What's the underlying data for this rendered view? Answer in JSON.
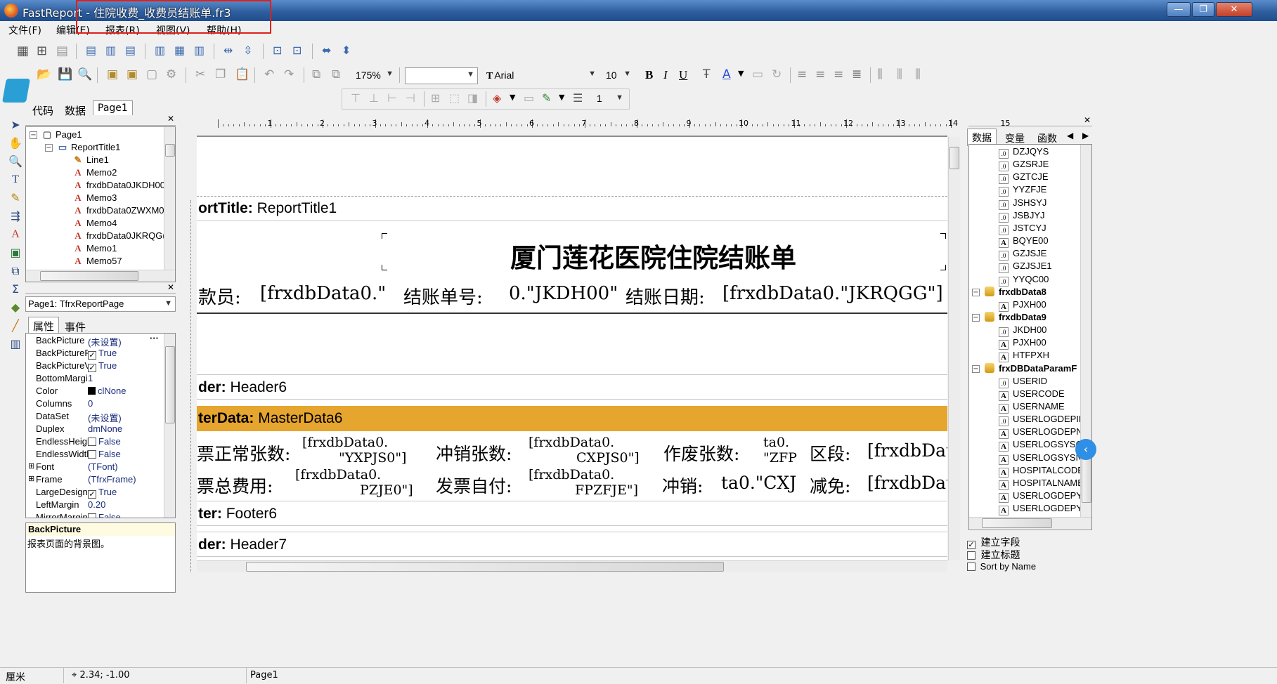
{
  "window": {
    "title": "FastReport - 住院收费_收费员结账单.fr3",
    "minimize": "—",
    "maximize": "❐",
    "close": "✕"
  },
  "menu": [
    "文件(F)",
    "编辑(E)",
    "报表(R)",
    "视图(V)",
    "帮助(H)"
  ],
  "toolbar": {
    "zoom": "175%",
    "font_name": "Arial",
    "font_size": "10",
    "bold": "B",
    "italic": "I",
    "underline": "U",
    "frame_width": "1"
  },
  "left_tabs": [
    "代码",
    "数据",
    "Page1"
  ],
  "report_tree": {
    "items": [
      "Page1",
      "ReportTitle1",
      "Line1",
      "Memo2",
      "frxdbData0JKDH00",
      "Memo3",
      "frxdbData0ZWXM0",
      "Memo4",
      "frxdbData0JKRQG(",
      "Memo1",
      "Memo57"
    ]
  },
  "inspector": {
    "object": "Page1: TfrxReportPage",
    "tabs": [
      "属性",
      "事件"
    ],
    "props": [
      {
        "name": "BackPicture",
        "value": "(未设置)"
      },
      {
        "name": "BackPicturePri",
        "value": "True"
      },
      {
        "name": "BackPictureVis",
        "value": "True"
      },
      {
        "name": "BottomMargin",
        "value": "1"
      },
      {
        "name": "Color",
        "value": "clNone"
      },
      {
        "name": "Columns",
        "value": "0"
      },
      {
        "name": "DataSet",
        "value": "(未设置)"
      },
      {
        "name": "Duplex",
        "value": "dmNone"
      },
      {
        "name": "EndlessHeight",
        "value": "False"
      },
      {
        "name": "EndlessWidth",
        "value": "False"
      },
      {
        "name": "Font",
        "value": "(TFont)"
      },
      {
        "name": "Frame",
        "value": "(TfrxFrame)"
      },
      {
        "name": "LargeDesignH",
        "value": "True"
      },
      {
        "name": "LeftMargin",
        "value": "0.20"
      },
      {
        "name": "MirrorMargins",
        "value": "False"
      }
    ],
    "help_title": "BackPicture",
    "help_text": "报表页面的背景图。"
  },
  "ruler": [
    "1",
    "2",
    "3",
    "4",
    "5",
    "6",
    "7",
    "8",
    "9",
    "10",
    "11",
    "12",
    "13",
    "14",
    "15"
  ],
  "design": {
    "report_title_band": {
      "label": "ortTitle:",
      "name": "ReportTitle1"
    },
    "report_heading": "厦门莲花医院住院结账单",
    "row1": [
      "款员:",
      "[frxdbData0.\"",
      "结账单号:",
      "0.\"JKDH00\"",
      "结账日期:",
      "[frxdbData0.\"JKRQGG\"]"
    ],
    "header6": {
      "label": "der:",
      "name": "Header6"
    },
    "master6": {
      "label": "terData:",
      "name": "MasterData6"
    },
    "master_row1": [
      "票正常张数:",
      "[frxdbData0.",
      "\"YXPJS0\"]",
      "冲销张数:",
      "[frxdbData0.",
      "CXPJS0\"]",
      "作废张数:",
      "ta0.",
      "\"ZFP",
      "区段:",
      "[frxdbDat"
    ],
    "master_row2": [
      "票总费用:",
      "[frxdbData0.",
      "PZJE0\"]",
      "发票自付:",
      "[frxdbData0.",
      "FPZFJE\"]",
      "冲销:",
      "ta0.\"CXJ",
      "减免:",
      "[frxdbDat"
    ],
    "footer6": {
      "label": "ter:",
      "name": "Footer6"
    },
    "header7": {
      "label": "der:",
      "name": "Header7"
    }
  },
  "right_tabs": [
    "数据",
    "变量",
    "函数"
  ],
  "data_tree": {
    "rows": [
      {
        "type": "num",
        "text": "DZJQYS"
      },
      {
        "type": "num",
        "text": "GZSRJE"
      },
      {
        "type": "num",
        "text": "GZTCJE"
      },
      {
        "type": "num",
        "text": "YYZFJE"
      },
      {
        "type": "num",
        "text": "JSHSYJ"
      },
      {
        "type": "num",
        "text": "JSBJYJ"
      },
      {
        "type": "num",
        "text": "JSTCYJ"
      },
      {
        "type": "str",
        "text": "BQYE00"
      },
      {
        "type": "num",
        "text": "GZJSJE"
      },
      {
        "type": "num",
        "text": "GZJSJE1"
      },
      {
        "type": "num",
        "text": "YYQC00"
      },
      {
        "type": "db",
        "text": "frxdbData8"
      },
      {
        "type": "str",
        "text": "PJXH00"
      },
      {
        "type": "db",
        "text": "frxdbData9"
      },
      {
        "type": "num",
        "text": "JKDH00"
      },
      {
        "type": "str",
        "text": "PJXH00"
      },
      {
        "type": "str",
        "text": "HTFPXH"
      },
      {
        "type": "db",
        "text": "frxDBDataParamF"
      },
      {
        "type": "num",
        "text": "USERID"
      },
      {
        "type": "str",
        "text": "USERCODE"
      },
      {
        "type": "str",
        "text": "USERNAME"
      },
      {
        "type": "num",
        "text": "USERLOGDEPID"
      },
      {
        "type": "str",
        "text": "USERLOGDEPNAI"
      },
      {
        "type": "str",
        "text": "USERLOGSYSCO"
      },
      {
        "type": "str",
        "text": "USERLOGSYSNAI"
      },
      {
        "type": "str",
        "text": "HOSPITALCODE"
      },
      {
        "type": "str",
        "text": "HOSPITALNAME"
      },
      {
        "type": "str",
        "text": "USERLOGDEPYYI"
      },
      {
        "type": "str",
        "text": "USERLOGDEPYYI"
      }
    ]
  },
  "options": [
    {
      "label": "建立字段",
      "checked": true
    },
    {
      "label": "建立标题",
      "checked": false
    },
    {
      "label": "Sort by Name",
      "checked": false
    }
  ],
  "status": {
    "unit": "厘米",
    "coords": "2.34; -1.00",
    "page": "Page1"
  },
  "colors": {
    "master_band": "#e6a52e",
    "title_bar": "#2f5f9f",
    "highlight": "#e0201a"
  }
}
